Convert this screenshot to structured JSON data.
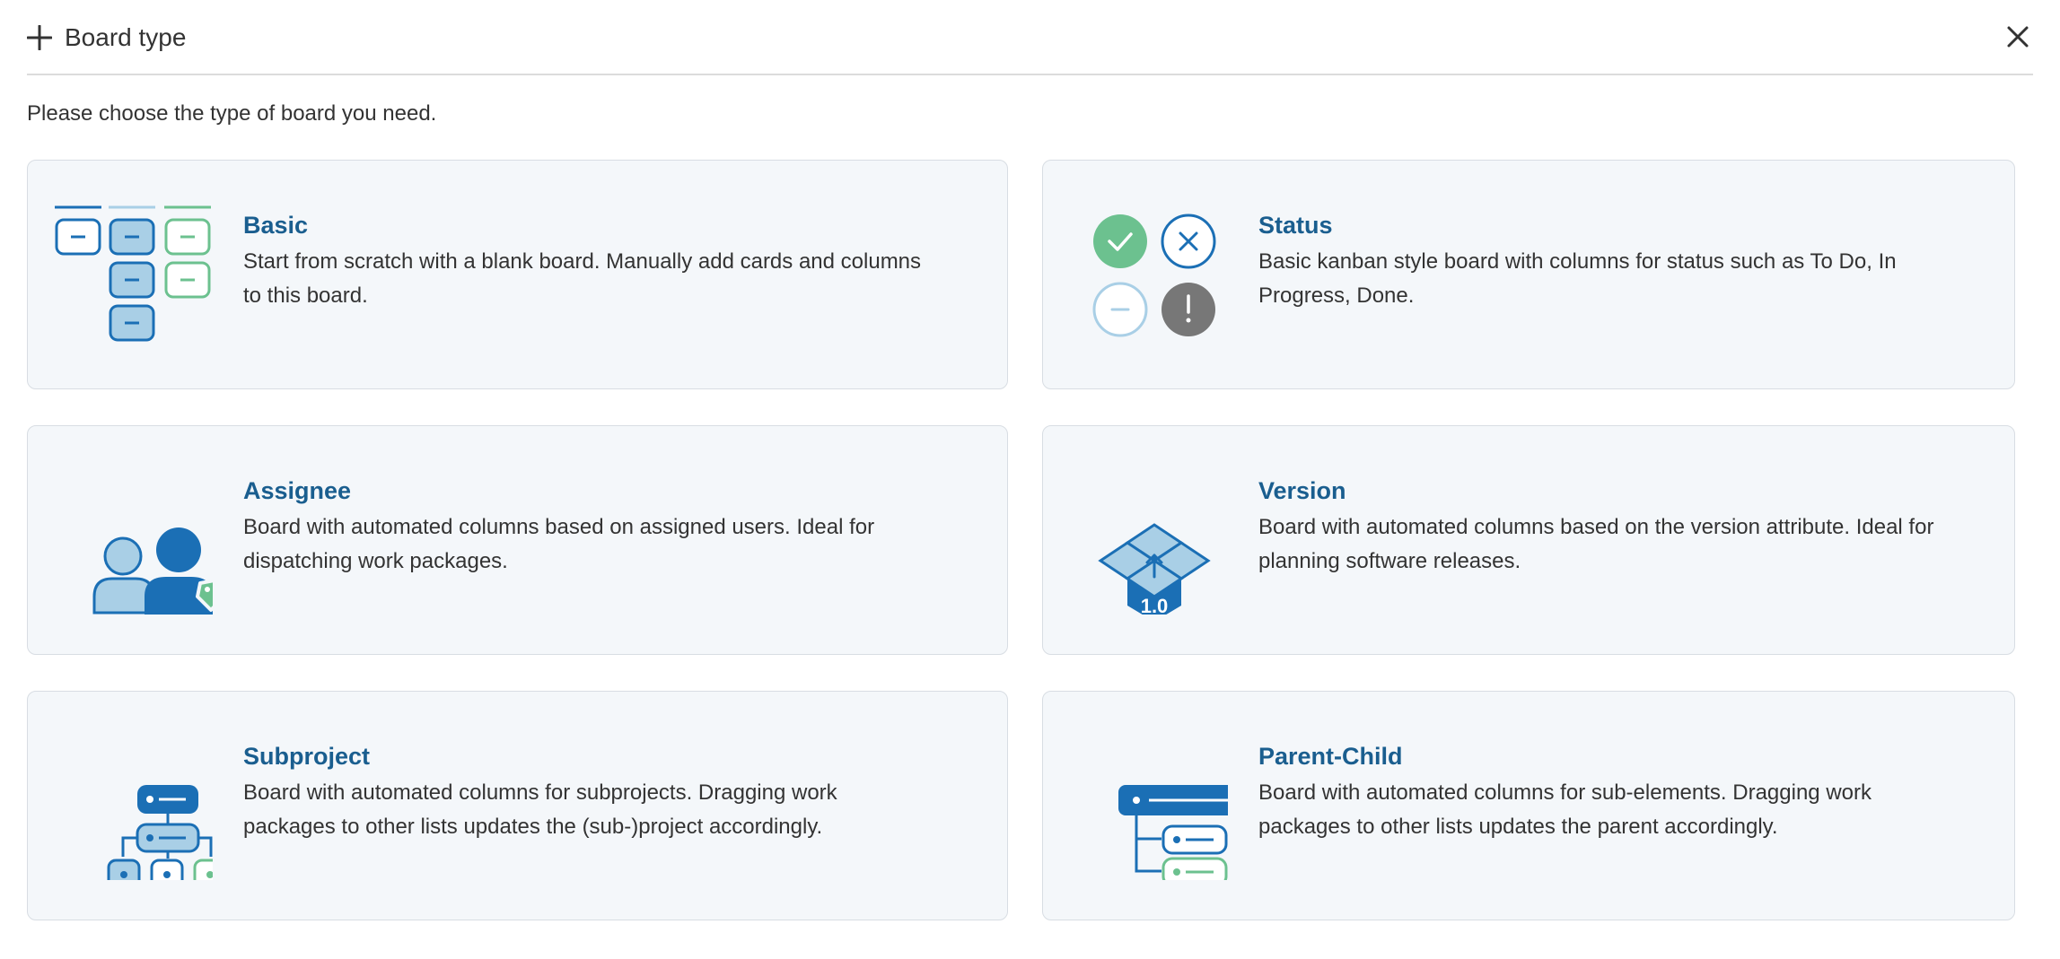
{
  "header": {
    "title": "Board type"
  },
  "intro": "Please choose the type of board you need.",
  "cards": [
    {
      "title": "Basic",
      "description": "Start from scratch with a blank board. Manually add cards and columns to this board."
    },
    {
      "title": "Status",
      "description": "Basic kanban style board with columns for status such as To Do, In Progress, Done."
    },
    {
      "title": "Assignee",
      "description": "Board with automated columns based on assigned users. Ideal for dispatching work packages."
    },
    {
      "title": "Version",
      "description": "Board with automated columns based on the version attribute. Ideal for planning software releases."
    },
    {
      "title": "Subproject",
      "description": "Board with automated columns for subprojects. Dragging work packages to other lists updates the (sub-)project accordingly."
    },
    {
      "title": "Parent-Child",
      "description": "Board with automated columns for sub-elements. Dragging work packages to other lists updates the parent accordingly."
    }
  ],
  "icons": {
    "add": "plus-icon",
    "close": "close-icon",
    "basic": "columns-board-icon",
    "status": "status-circles-icon",
    "assignee": "users-tag-icon",
    "version": "version-box-icon",
    "version_label": "1.0",
    "subproject": "hierarchy-icon",
    "parent_child": "parent-child-icon"
  },
  "colors": {
    "accent": "#1a5e8f",
    "dark_blue": "#1b6fb5",
    "light_blue": "#a9cfe6",
    "green": "#6cc18f",
    "grey": "#777777",
    "card_bg": "#f4f7fa"
  }
}
